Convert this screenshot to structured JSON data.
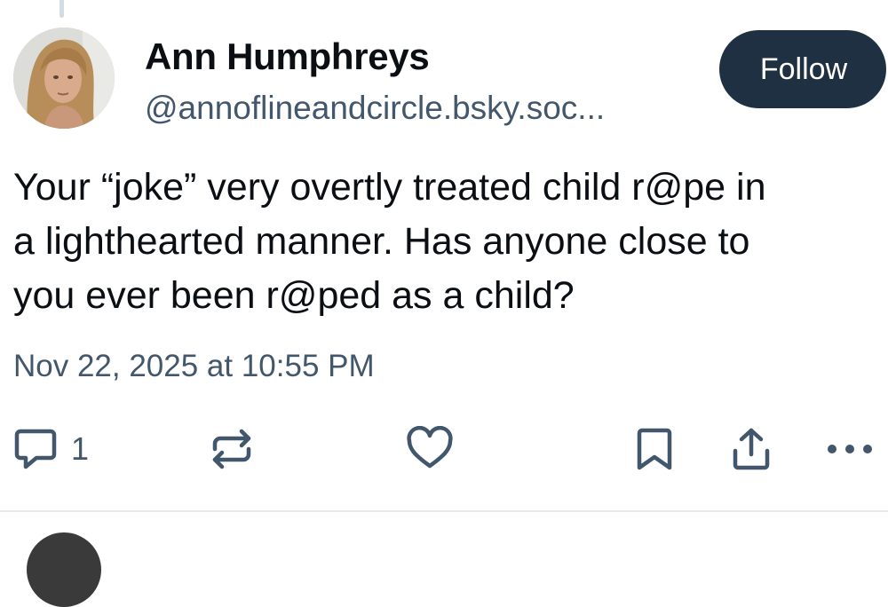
{
  "post": {
    "author": {
      "display_name": "Ann Humphreys",
      "handle": "@annoflineandcircle.bsky.soc..."
    },
    "follow_label": "Follow",
    "text": "Your “joke” very overtly treated child r@pe in\na lighthearted manner. Has anyone close to\nyou ever been r@ped as a child?",
    "timestamp": "Nov 22, 2025 at 10:55 PM",
    "actions": {
      "reply_count": "1",
      "icons": [
        "reply-icon",
        "repost-icon",
        "like-icon",
        "bookmark-icon",
        "share-icon",
        "more-icon"
      ]
    }
  },
  "colors": {
    "primary_text": "#0b0f14",
    "secondary_text": "#42576c",
    "follow_button_bg": "#1f3042",
    "follow_button_text": "#ffffff",
    "divider": "#e8ecf0"
  }
}
